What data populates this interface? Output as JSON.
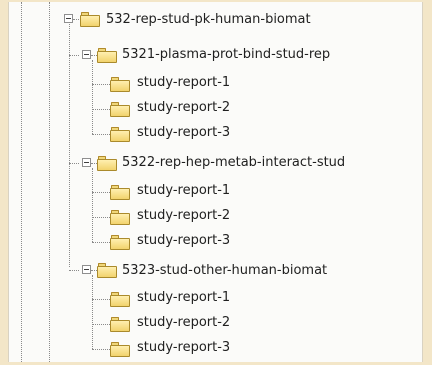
{
  "tree": {
    "root": {
      "label": "532-rep-stud-pk-human-biomat",
      "icon": "folder-icon"
    },
    "children": [
      {
        "label": "5321-plasma-prot-bind-stud-rep",
        "icon": "folder-icon",
        "children": [
          {
            "label": "study-report-1",
            "icon": "folder-icon"
          },
          {
            "label": "study-report-2",
            "icon": "folder-icon"
          },
          {
            "label": "study-report-3",
            "icon": "folder-icon"
          }
        ]
      },
      {
        "label": "5322-rep-hep-metab-interact-stud",
        "icon": "folder-icon",
        "children": [
          {
            "label": "study-report-1",
            "icon": "folder-icon"
          },
          {
            "label": "study-report-2",
            "icon": "folder-icon"
          },
          {
            "label": "study-report-3",
            "icon": "folder-icon"
          }
        ]
      },
      {
        "label": "5323-stud-other-human-biomat",
        "icon": "folder-icon",
        "children": [
          {
            "label": "study-report-1",
            "icon": "folder-icon"
          },
          {
            "label": "study-report-2",
            "icon": "folder-icon"
          },
          {
            "label": "study-report-3",
            "icon": "folder-icon"
          }
        ]
      }
    ]
  }
}
